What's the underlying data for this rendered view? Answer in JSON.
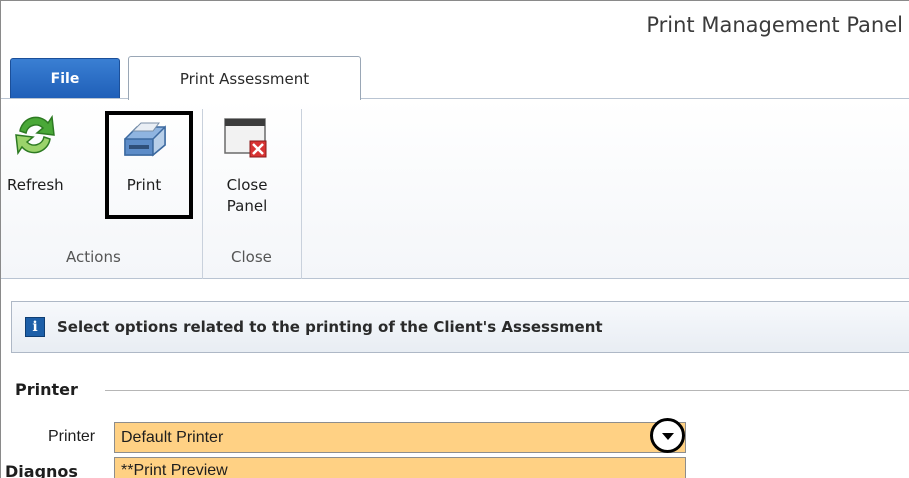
{
  "window": {
    "title": "Print Management Panel"
  },
  "tabs": [
    {
      "label": "File"
    },
    {
      "label": "Print Assessment"
    }
  ],
  "ribbon": {
    "buttons": [
      {
        "label": "Refresh",
        "icon": "refresh-icon"
      },
      {
        "label": "Print",
        "icon": "printer-icon"
      },
      {
        "label": "Close Panel",
        "icon": "close-panel-icon"
      }
    ],
    "groups": [
      {
        "label": "Actions"
      },
      {
        "label": "Close"
      }
    ]
  },
  "info_bar": {
    "icon": "info-icon",
    "icon_glyph": "i",
    "text": "Select options related to the printing of the Client's Assessment"
  },
  "printer_section": {
    "title": "Printer",
    "field_label": "Printer",
    "selected_value": "Default Printer",
    "options": [
      "**Print Preview"
    ],
    "next_section_partial": "Diagnos"
  },
  "colors": {
    "file_tab": "#1f5fb8",
    "select_bg": "#ffd184",
    "info_icon": "#1d5fa8"
  }
}
